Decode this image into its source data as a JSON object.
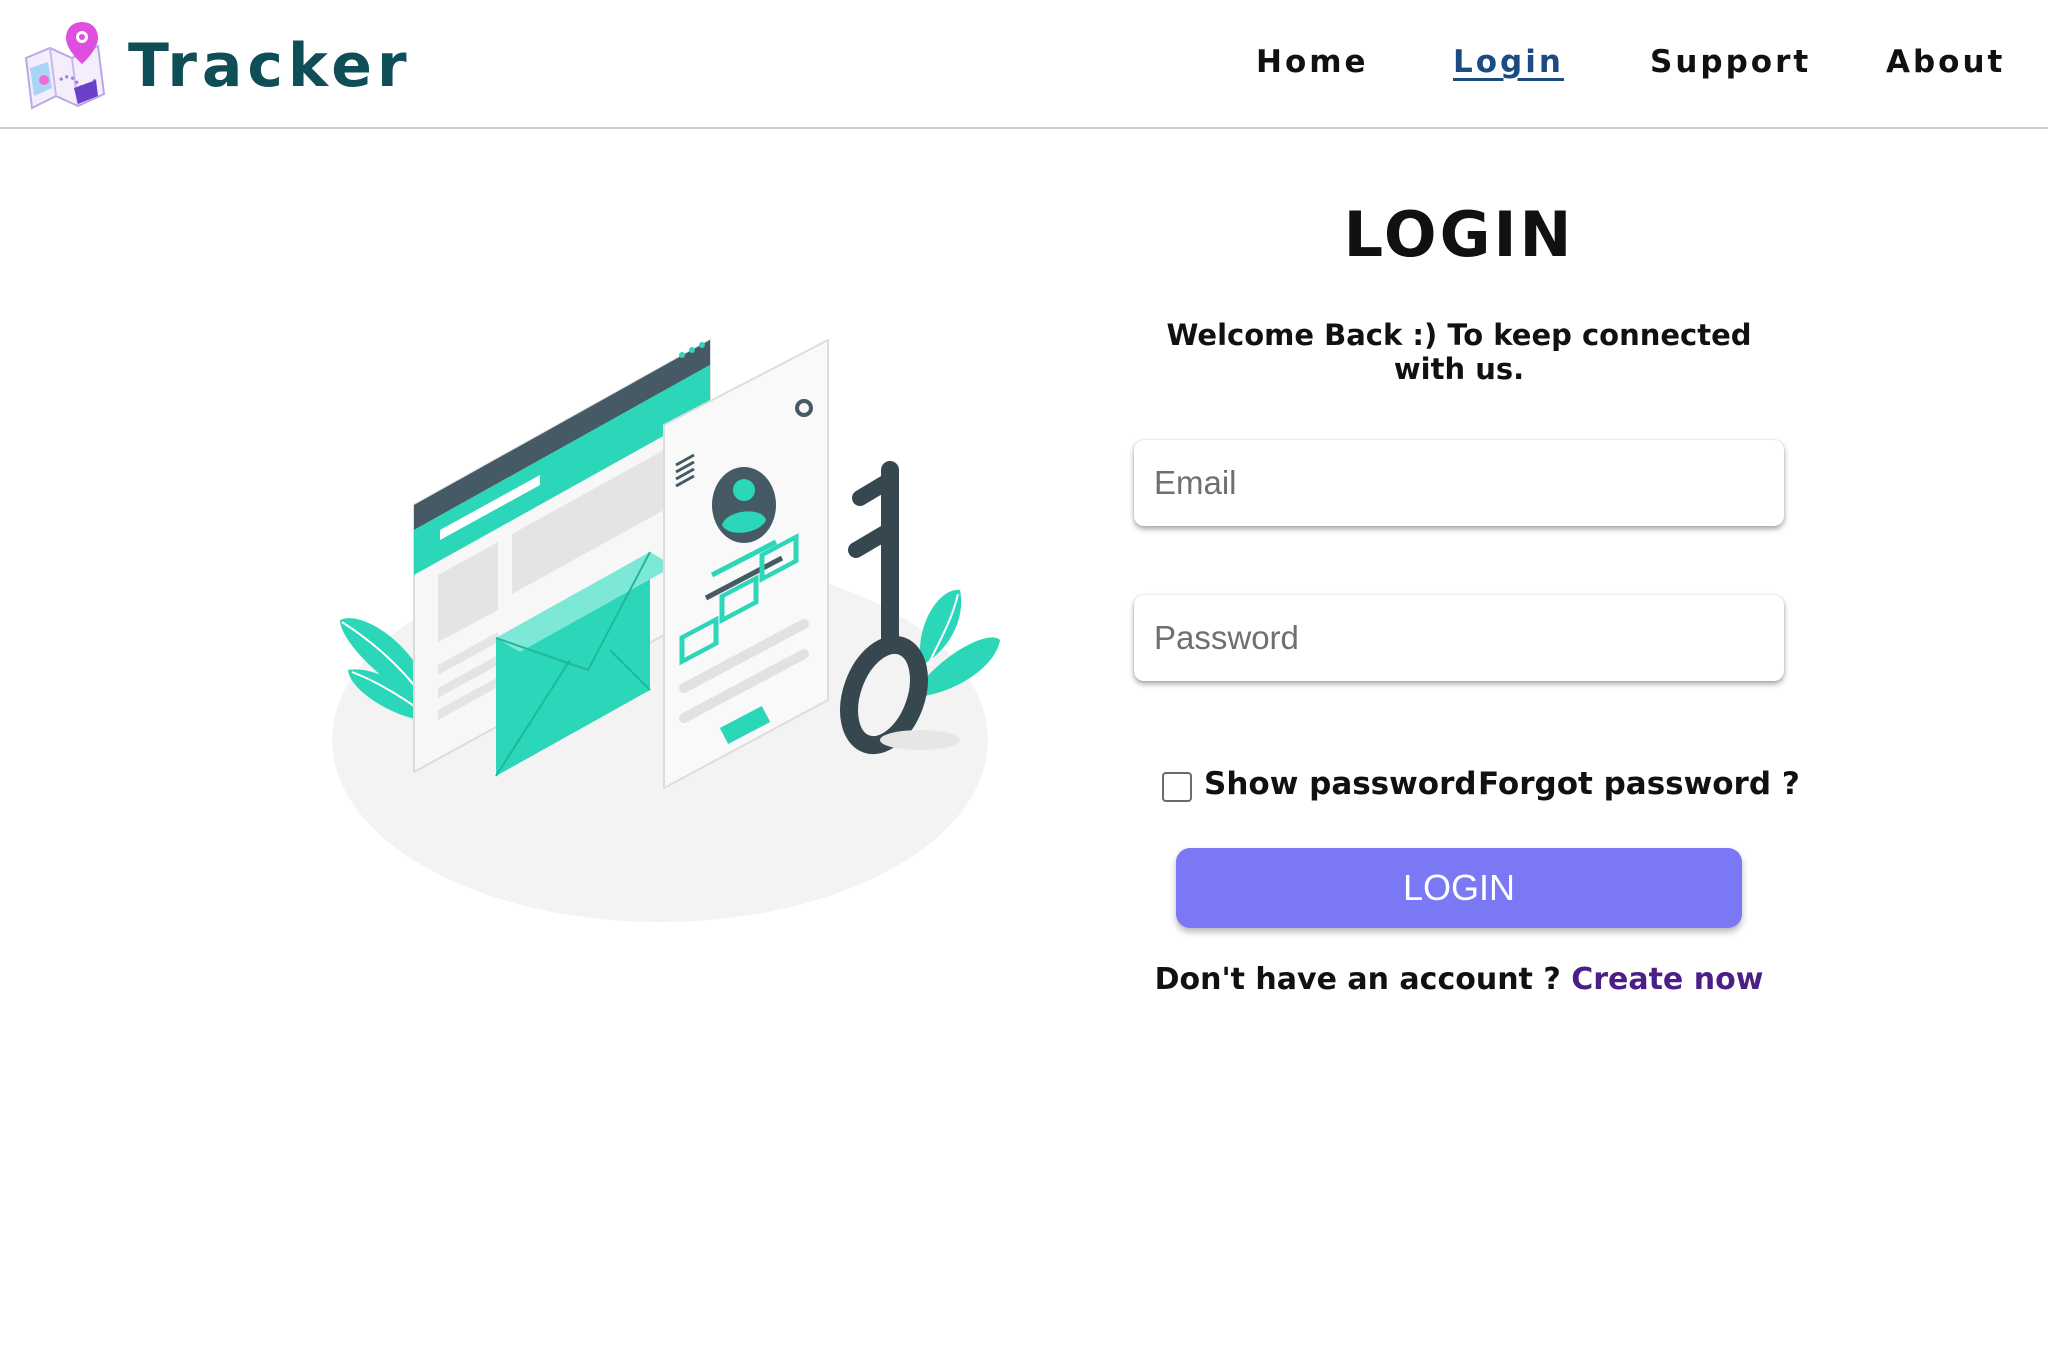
{
  "brand": {
    "name": "Tracker"
  },
  "nav": {
    "items": [
      {
        "label": "Home",
        "active": false
      },
      {
        "label": "Login",
        "active": true
      },
      {
        "label": "Support",
        "active": false
      },
      {
        "label": "About",
        "active": false
      }
    ]
  },
  "form": {
    "title": "LOGIN",
    "subtitle": "Welcome Back :) To keep connected with us.",
    "email_placeholder": "Email",
    "password_placeholder": "Password",
    "show_password_label": "Show password",
    "show_password_checked": false,
    "forgot_password_label": "Forgot password ?",
    "submit_label": "LOGIN",
    "signup_prompt": "Don't have an account ?",
    "signup_link": "Create now"
  },
  "colors": {
    "brand_text": "#0d4e57",
    "active_nav": "#1c4b82",
    "button_bg": "#7b78f5",
    "link": "#4b1f85",
    "accent_teal": "#2bd6b9",
    "dark_slate": "#37474f"
  },
  "icons": {
    "brand_logo": "map-pin-logo-icon",
    "illustration": "login-security-illustration"
  }
}
